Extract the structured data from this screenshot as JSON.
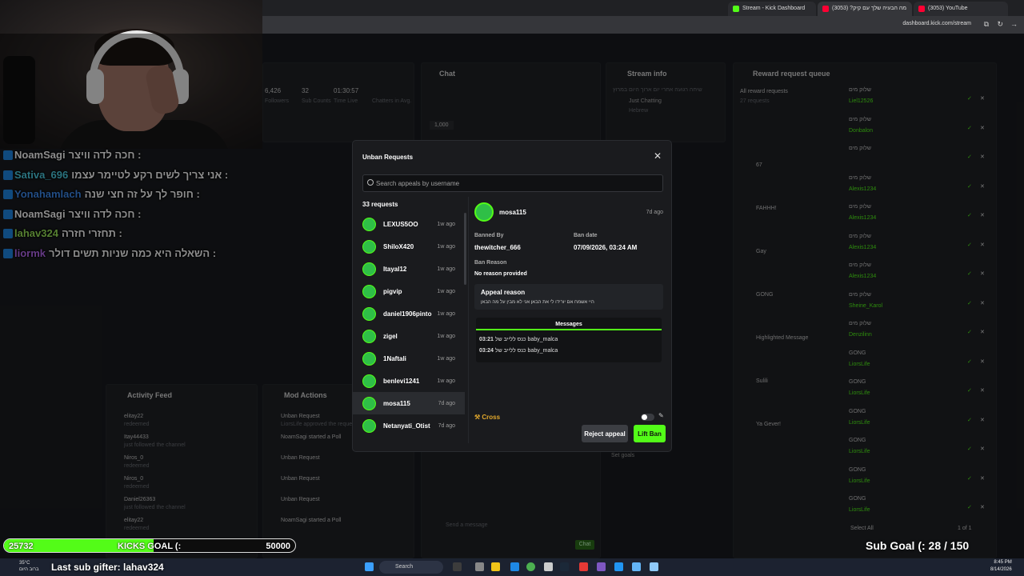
{
  "browser": {
    "tabs": [
      {
        "title": "Stream - Kick Dashboard",
        "active": false
      },
      {
        "title": "(3053) ?מה הבעיה שלך עם קיק",
        "active": true
      },
      {
        "title": "(3053) YouTube",
        "active": false
      }
    ],
    "url": "dashboard.kick.com/stream"
  },
  "dashboard": {
    "chat_title": "Chat",
    "stream_info_title": "Stream info",
    "stream_info_category": "Just Chatting",
    "stream_info_language": "Hebrew",
    "stream_info_text": "שיחה רגועה אחרי יום ארוך היום במרוץ",
    "reward_title": "Reward request queue",
    "all_rewards": "All reward requests",
    "all_rewards_count": "27 requests",
    "activity_title": "Activity Feed",
    "mod_actions_title": "Mod Actions",
    "stats": [
      {
        "value": "6,426",
        "label": "Followers"
      },
      {
        "value": "32",
        "label": "Sub Counts"
      },
      {
        "value": "01:30:57",
        "label": "Time Live"
      },
      {
        "value": "",
        "label": "Chatters in Avg."
      }
    ],
    "activity": [
      {
        "user": "elitay22",
        "action": "redeemed"
      },
      {
        "user": "Itay44433",
        "action": "just followed the channel"
      },
      {
        "user": "Niros_0",
        "action": "redeemed"
      },
      {
        "user": "Niros_0",
        "action": "redeemed"
      },
      {
        "user": "Daniel26363",
        "action": "just followed the channel"
      },
      {
        "user": "elitay22",
        "action": "redeemed"
      }
    ],
    "mod_actions": [
      {
        "title": "Unban Request",
        "sub": "LiorsLife approved the request"
      },
      {
        "title": "NoamSagi started a Poll",
        "sub": ""
      },
      {
        "title": "Unban Request",
        "sub": ""
      },
      {
        "title": "Unban Request",
        "sub": ""
      },
      {
        "title": "Unban Request",
        "sub": ""
      },
      {
        "title": "NoamSagi started a Poll",
        "sub": ""
      }
    ],
    "rewards": [
      {
        "title": "שלוק מים",
        "user": "Liel12526"
      },
      {
        "title": "שלוק מים",
        "user": "Donbalon"
      },
      {
        "title": "שלוק מים",
        "user": ""
      },
      {
        "title": "שלוק מים",
        "user": "Alexis1234"
      },
      {
        "title": "שלוק מים",
        "user": "Alexis1234"
      },
      {
        "title": "שלוק מים",
        "user": "Alexis1234"
      },
      {
        "title": "שלוק מים",
        "user": "Alexis1234"
      },
      {
        "title": "שלוק מים",
        "user": "Sheine_Karol"
      },
      {
        "title": "שלוק מים",
        "user": "Denzilinn"
      },
      {
        "title": "GONG",
        "user": "LiorsLife"
      },
      {
        "title": "GONG",
        "user": "LiorsLife"
      },
      {
        "title": "GONG",
        "user": "LiorsLife"
      },
      {
        "title": "GONG",
        "user": "LiorsLife"
      },
      {
        "title": "GONG",
        "user": "LiorsLife"
      },
      {
        "title": "GONG",
        "user": "LiorsLife"
      }
    ],
    "reward_items": [
      "67",
      "FAHHH!",
      "Gay",
      "GONG",
      "Highlighted Message",
      "Sulili",
      "Ya Gever!"
    ],
    "select_all": "Select All",
    "pagination": "1 of 1",
    "set_goals": "Set goals",
    "send_message": "Send a message",
    "chat_button": "Chat"
  },
  "chat_overlay": [
    {
      "user": "NoamSagi",
      "color": "#ffffff",
      "text": "חכה לדה וויצר :"
    },
    {
      "user": "Sativa_696",
      "color": "#4fd1e8",
      "text": "אני צריך לשים רקע לטיימר עצמו :"
    },
    {
      "user": "Yonahamlach",
      "color": "#3f8ef5",
      "text": "חופר לך על זה חצי שנה :"
    },
    {
      "user": "NoamSagi",
      "color": "#ffffff",
      "text": "חכה לדה וויצר :"
    },
    {
      "user": "lahav324",
      "color": "#9be85a",
      "text": "תחזרי חזרה :"
    },
    {
      "user": "liormk",
      "color": "#b96bf2",
      "text": "השאלה היא כמה שניות תשים דולר :"
    }
  ],
  "modal": {
    "title": "Unban Requests",
    "search_placeholder": "Search appeals by username",
    "count": "33 requests",
    "requests": [
      {
        "name": "LEXUS5OO",
        "time": "1w ago"
      },
      {
        "name": "ShiloX420",
        "time": "1w ago"
      },
      {
        "name": "Itayal12",
        "time": "1w ago"
      },
      {
        "name": "pigvip",
        "time": "1w ago"
      },
      {
        "name": "daniel1906pinto",
        "time": "1w ago"
      },
      {
        "name": "zigel",
        "time": "1w ago"
      },
      {
        "name": "1Naftali",
        "time": "1w ago"
      },
      {
        "name": "benlevi1241",
        "time": "1w ago"
      },
      {
        "name": "mosa115",
        "time": "7d ago",
        "selected": true
      },
      {
        "name": "Netanyati_Otist",
        "time": "7d ago"
      }
    ],
    "detail": {
      "name": "mosa115",
      "time": "7d ago",
      "banned_by_label": "Banned By",
      "banned_by": "thewitcher_666",
      "ban_date_label": "Ban date",
      "ban_date": "07/09/2026, 03:24 AM",
      "ban_reason_label": "Ban Reason",
      "ban_reason": "No reason provided",
      "appeal_label": "Appeal reason",
      "appeal_text": "היי אשמח אם יורידו לי את הבאן אני לא מבין על מה הבאן",
      "messages_label": "Messages",
      "messages": [
        {
          "time": "03:21",
          "text": "כנס ללייב של baby_malca"
        },
        {
          "time": "03:24",
          "text": "כנס ללייב של baby_malca"
        }
      ],
      "cross_label": "Cross",
      "reject_label": "Reject appeal",
      "lift_label": "Lift Ban"
    }
  },
  "overlay_widgets": {
    "goal_current": "25732",
    "goal_label": "KICKS GOAL (:",
    "goal_target": "50000",
    "goal_progress": 0.515,
    "last_sub": "Last sub gifter: lahav324",
    "sub_goal": "Sub Goal (: 28 / 150"
  },
  "taskbar": {
    "search": "Search",
    "weather": "35°C\nברוב היום",
    "time": "8:45 PM",
    "date": "8/14/2026"
  },
  "colors": {
    "accent": "#53fc18",
    "overlay_blue": "#1e88e5"
  }
}
